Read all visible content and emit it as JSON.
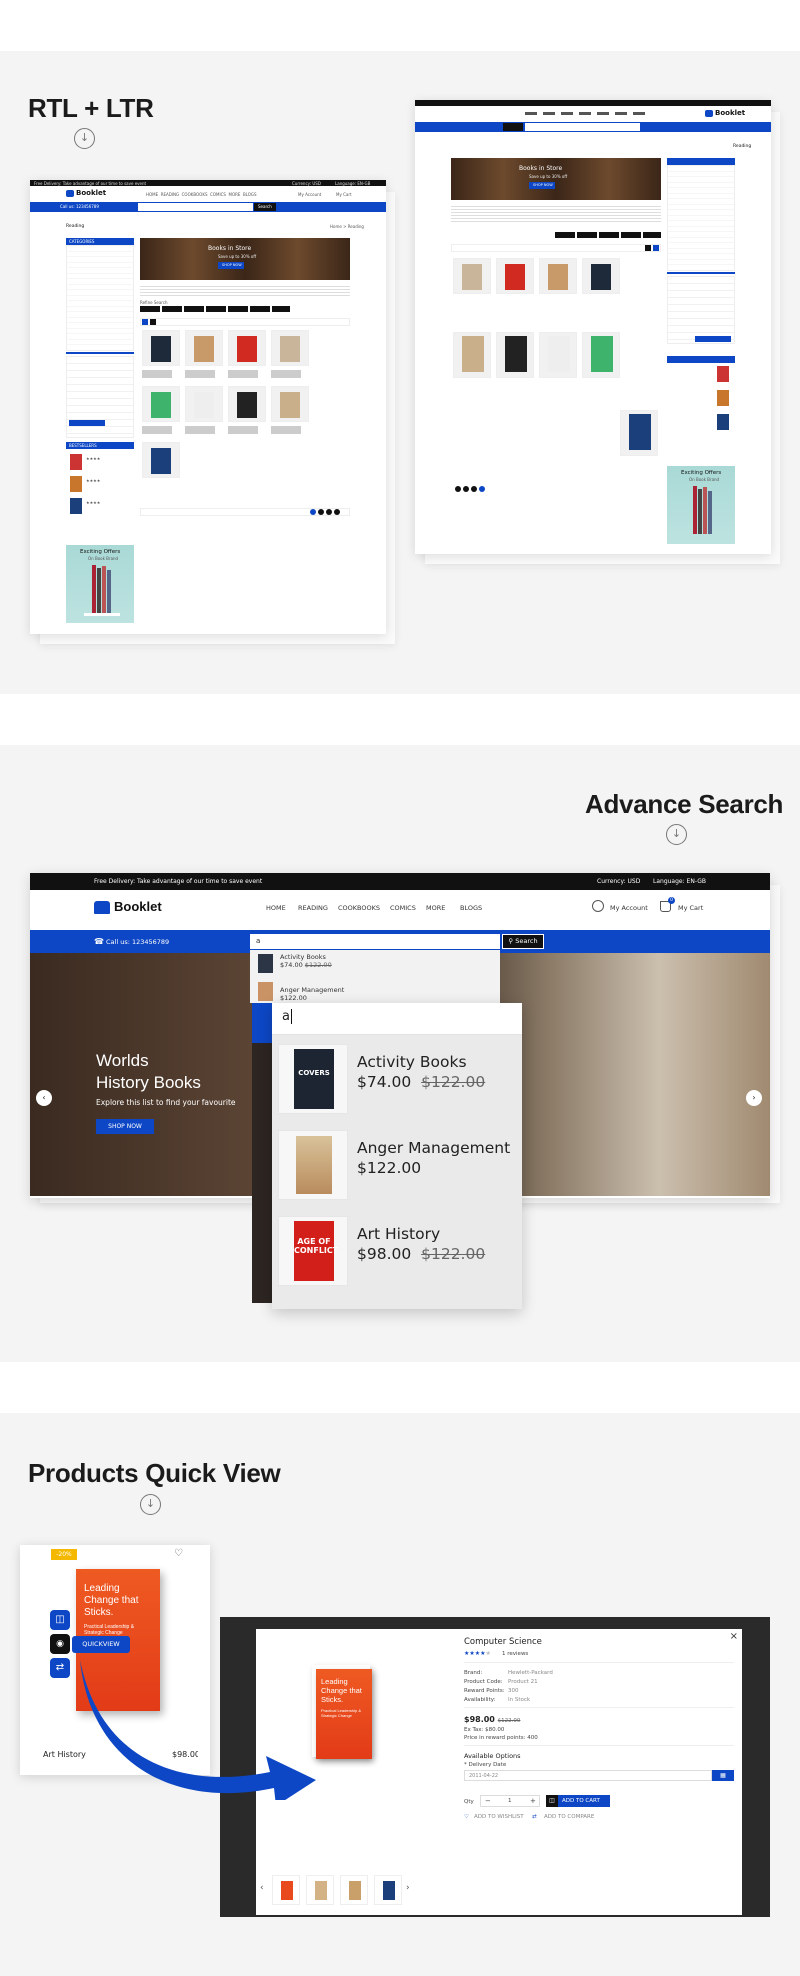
{
  "sections": {
    "rtl_ltr": {
      "title": "RTL + LTR"
    },
    "advance_search": {
      "title": "Advance Search"
    },
    "quick_view": {
      "title": "Products Quick View"
    }
  },
  "colors": {
    "brand_blue": "#0d47c5",
    "top_bar": "#111111",
    "sale_badge": "#f5b800"
  },
  "ltr_preview": {
    "top_left": "Free Delivery: Take advantage of our time to save event",
    "top_right_currency": "Currency: USD",
    "top_right_language": "Language: EN-GB",
    "logo": "Booklet",
    "nav": [
      "HOME",
      "READING",
      "COOKBOOKS",
      "COMICS",
      "MORE",
      "BLOGS"
    ],
    "account": "My Account",
    "cart": "My Cart",
    "phone": "Call us: 123456789",
    "search_btn": "Search",
    "page_heading": "Reading",
    "breadcrumb": "Home > Reading",
    "categories_title": "CATEGORIES",
    "banner_title": "Books in Store",
    "banner_sub": "Save up to 30% off",
    "banner_btn": "SHOP NOW",
    "refine_title": "Refine Search",
    "bestsellers_title": "BESTSELLERS",
    "offer_title": "Exciting Offers",
    "offer_sub": "On Book Brand"
  },
  "rtl_preview": {
    "logo": "Booklet",
    "page_heading": "Reading",
    "banner_title": "Books in Store",
    "banner_sub": "Save up to 30% off",
    "banner_btn": "SHOP NOW",
    "offer_title": "Exciting Offers",
    "offer_sub": "On Book Brand"
  },
  "search_demo": {
    "top_left": "Free Delivery: Take advantage of our time to save event",
    "currency": "Currency: USD",
    "language": "Language: EN-GB",
    "logo": "Booklet",
    "nav": [
      "HOME",
      "READING",
      "COOKBOOKS",
      "COMICS",
      "MORE",
      "BLOGS"
    ],
    "account": "My Account",
    "cart": "My Cart",
    "cart_count": "0",
    "phone": "Call us: 123456789",
    "search_value": "a",
    "search_btn": "Search",
    "hero_title_1": "Worlds",
    "hero_title_2": "History Books",
    "hero_sub": "Explore this list to find your favourite",
    "hero_btn": "SHOP NOW",
    "dropdown_small": [
      {
        "name": "Activity Books",
        "price": "$74.00",
        "old": "$122.00"
      },
      {
        "name": "Anger Management",
        "price": "$122.00",
        "old": ""
      }
    ],
    "zoom_input": "a",
    "zoom_results": [
      {
        "name": "Activity Books",
        "price": "$74.00",
        "old": "$122.00",
        "cover": "COVERS"
      },
      {
        "name": "Anger Management",
        "price": "$122.00",
        "old": "",
        "cover": ""
      },
      {
        "name": "Art History",
        "price": "$98.00",
        "old": "$122.00",
        "cover": "AGE OF CONFLICT"
      }
    ]
  },
  "quick_view": {
    "card": {
      "badge": "-20%",
      "product_name": "Art History",
      "price_partial": "$98.00",
      "quickview_label": "QUICKVIEW",
      "book_title": "Leading Change that Sticks.",
      "book_sub": "Practical Leadership & Strategic Change"
    },
    "modal": {
      "title": "Computer Science",
      "reviews": "1 reviews",
      "rating": 4,
      "brand_label": "Brand:",
      "brand": "Hewlett-Packard",
      "code_label": "Product Code:",
      "code": "Product 21",
      "points_label": "Reward Points:",
      "points": "300",
      "avail_label": "Availability:",
      "avail": "In Stock",
      "price": "$98.00",
      "old_price": "$122.00",
      "ex_tax": "Ex Tax: $80.00",
      "reward": "Price in reward points: 400",
      "options_title": "Available Options",
      "delivery_label": "* Delivery Date",
      "delivery_value": "2011-04-22",
      "qty_label": "Qty",
      "qty": "1",
      "add_to_cart": "ADD TO CART",
      "wishlist": "ADD TO WISHLIST",
      "compare": "ADD TO COMPARE",
      "book_title": "Leading Change that Sticks.",
      "book_sub": "Practical Leadership & Strategic Change",
      "close": "×"
    }
  }
}
